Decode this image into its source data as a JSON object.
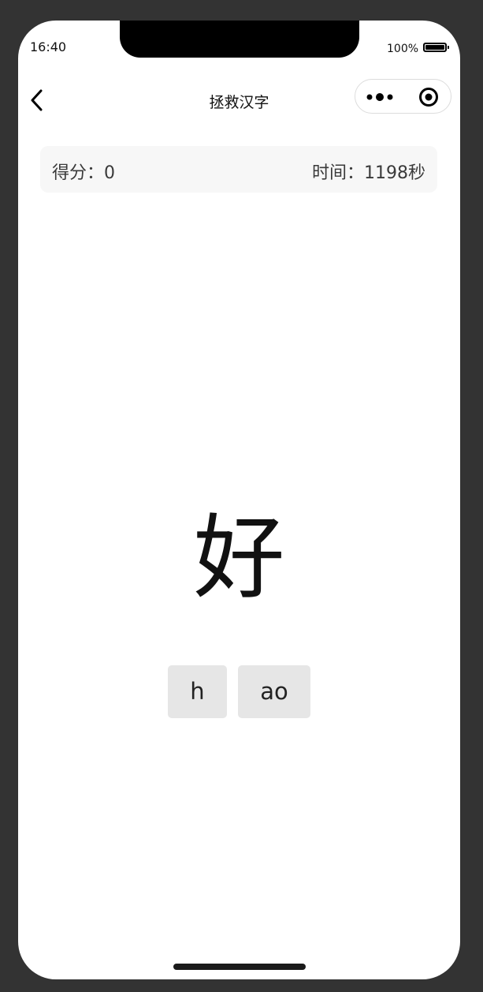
{
  "status_bar": {
    "time": "16:40",
    "battery_percent": "100%"
  },
  "nav": {
    "title": "拯救汉字",
    "back_icon": "chevron-left-icon",
    "more_icon": "more-dots-icon",
    "close_icon": "target-circle-icon"
  },
  "scoreboard": {
    "score_label": "得分：",
    "score_value": "0",
    "time_label": "时间：",
    "time_value": "1198",
    "time_unit": "秒"
  },
  "game": {
    "character": "好",
    "pinyin_parts": [
      "h",
      "ao"
    ]
  }
}
